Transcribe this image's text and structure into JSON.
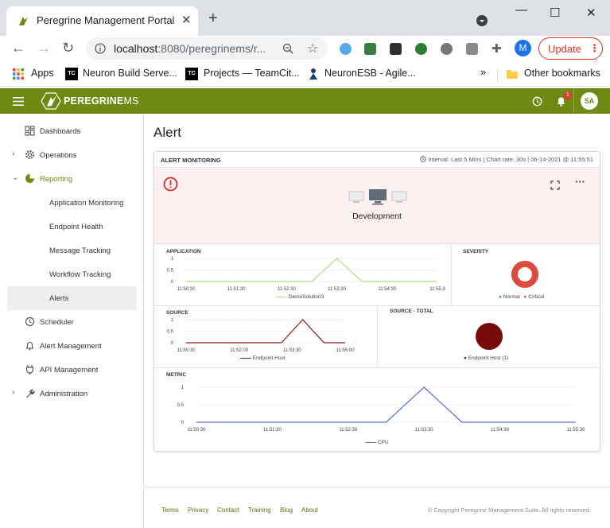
{
  "browser": {
    "tab_title": "Peregrine Management Portal",
    "url_host": "localhost",
    "url_rest": ":8080/peregrinems/r...",
    "update_label": "Update",
    "profile_initial": "M",
    "bookmarks": [
      {
        "label": "Apps"
      },
      {
        "label": "Neuron Build Serve..."
      },
      {
        "label": "Projects — TeamCit..."
      },
      {
        "label": "NeuronESB - Agile..."
      }
    ],
    "other_bookmarks": "Other bookmarks"
  },
  "app": {
    "brand_bold": "PEREGRINE",
    "brand_light": "MS",
    "notification_count": "1",
    "user_initials": "SA",
    "accent": "#6e8a12"
  },
  "sidebar": {
    "items": [
      {
        "label": "Dashboards"
      },
      {
        "label": "Operations"
      },
      {
        "label": "Reporting"
      },
      {
        "label": "Application Monitoring"
      },
      {
        "label": "Endpoint Health"
      },
      {
        "label": "Message Tracking"
      },
      {
        "label": "Workflow Tracking"
      },
      {
        "label": "Alerts"
      },
      {
        "label": "Scheduler"
      },
      {
        "label": "Alert Management"
      },
      {
        "label": "API Management"
      },
      {
        "label": "Administration"
      }
    ]
  },
  "page": {
    "title": "Alert",
    "card_title": "ALERT MONITORING",
    "interval": "Interval: Last 5 Mins",
    "chart_rate": "|  Chart rate: 30s | 06-14-2021 @ 11:55:51",
    "environment": "Development"
  },
  "chart_data": [
    {
      "type": "line",
      "title": "APPLICATION",
      "x": [
        "11:50:30",
        "11:51:30",
        "11:52:30",
        "11:53:30",
        "11:54:30",
        "11:55:3"
      ],
      "ytick_labels": [
        "1",
        "0.5",
        "0"
      ],
      "ylim": [
        0,
        1
      ],
      "series": [
        {
          "name": "DemoSolution3",
          "points": [
            [
              0,
              0
            ],
            [
              1,
              0
            ],
            [
              2,
              0
            ],
            [
              2.5,
              0
            ],
            [
              3,
              1
            ],
            [
              3.5,
              0
            ],
            [
              4,
              0
            ],
            [
              5,
              0
            ]
          ],
          "color": "#b5d98c"
        }
      ]
    },
    {
      "type": "pie",
      "title": "SEVERITY",
      "categories": [
        "Normal",
        "Critical"
      ],
      "values": [
        0,
        1
      ],
      "colors": [
        "#2e9e6b",
        "#e04a3c"
      ]
    },
    {
      "type": "line",
      "title": "SOURCE",
      "x": [
        "11:50:30",
        "11:52:00",
        "11:53:30",
        "11:55:00"
      ],
      "ytick_labels": [
        "1",
        "0.5",
        "0"
      ],
      "ylim": [
        0,
        1
      ],
      "series": [
        {
          "name": "Endpoint Host",
          "points": [
            [
              0,
              0
            ],
            [
              1.8,
              0
            ],
            [
              2.2,
              1
            ],
            [
              2.6,
              0
            ],
            [
              3,
              0
            ]
          ],
          "color": "#8b1a1a"
        }
      ]
    },
    {
      "type": "pie",
      "title": "SOURCE - TOTAL",
      "categories": [
        "Endpoint Host (1)"
      ],
      "values": [
        1
      ],
      "colors": [
        "#7a0a0a"
      ]
    },
    {
      "type": "line",
      "title": "METRIC",
      "x": [
        "11:50:30",
        "11:51:30",
        "11:52:30",
        "11:53:30",
        "11:54:30",
        "11:55:30"
      ],
      "ytick_labels": [
        "1",
        "0.5",
        "0"
      ],
      "ylim": [
        0,
        1
      ],
      "series": [
        {
          "name": "CPU",
          "points": [
            [
              0,
              0
            ],
            [
              1,
              0
            ],
            [
              2,
              0
            ],
            [
              2.5,
              0
            ],
            [
              3,
              1
            ],
            [
              3.5,
              0
            ],
            [
              4,
              0
            ],
            [
              5,
              0
            ]
          ],
          "color": "#5b6fd6"
        }
      ]
    }
  ],
  "footer": {
    "links": [
      "Terms",
      "Privacy",
      "Contact",
      "Training",
      "Blog",
      "About"
    ],
    "copyright": "© Copyright Peregrine Management Suite. All rights reserved."
  }
}
